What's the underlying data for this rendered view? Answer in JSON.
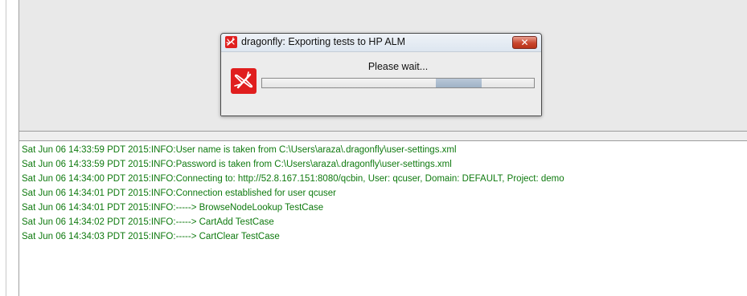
{
  "dialog": {
    "title": "dragonfly: Exporting tests to HP ALM",
    "message": "Please wait...",
    "close_glyph": "✕",
    "title_icon": "dragonfly-icon",
    "body_icon": "dragonfly-icon",
    "brand_color": "#e01e1e",
    "progress": {
      "indeterminate": true,
      "segment_start_fraction": 0.64,
      "segment_fraction": 0.17
    }
  },
  "log": {
    "text_color": "#0f7a0f",
    "lines": [
      "Sat Jun 06 14:33:59 PDT 2015:INFO:User name is taken from C:\\Users\\araza\\.dragonfly\\user-settings.xml",
      "Sat Jun 06 14:33:59 PDT 2015:INFO:Password is taken from C:\\Users\\araza\\.dragonfly\\user-settings.xml",
      "Sat Jun 06 14:34:00 PDT 2015:INFO:Connecting to: http://52.8.167.151:8080/qcbin, User: qcuser, Domain: DEFAULT, Project: demo",
      "Sat Jun 06 14:34:01 PDT 2015:INFO:Connection established for user qcuser",
      "Sat Jun 06 14:34:01 PDT 2015:INFO:-----> BrowseNodeLookup TestCase",
      "Sat Jun 06 14:34:02 PDT 2015:INFO:-----> CartAdd TestCase",
      "Sat Jun 06 14:34:03 PDT 2015:INFO:-----> CartClear TestCase"
    ]
  }
}
